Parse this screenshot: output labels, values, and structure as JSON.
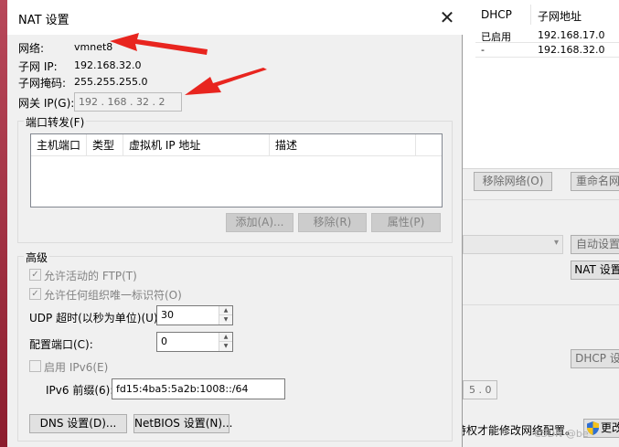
{
  "dialog": {
    "title": "NAT 设置",
    "close_icon": "close-icon",
    "network_label": "网络:",
    "network_value": "vmnet8",
    "subnet_ip_label": "子网 IP:",
    "subnet_ip_value": "192.168.32.0",
    "subnet_mask_label": "子网掩码:",
    "subnet_mask_value": "255.255.255.0",
    "gateway_label": "网关 IP(G):",
    "gateway_value": "192 . 168 . 32 . 2",
    "port_forwarding": {
      "title": "端口转发(F)",
      "columns": [
        "主机端口",
        "类型",
        "虚拟机 IP 地址",
        "描述"
      ],
      "add_button": "添加(A)...",
      "remove_button": "移除(R)",
      "properties_button": "属性(P)"
    },
    "advanced": {
      "title": "高级",
      "allow_ftp": "允许活动的 FTP(T)",
      "allow_ftp_checked": true,
      "allow_oui": "允许任何组织唯一标识符(O)",
      "allow_oui_checked": true,
      "udp_timeout_label": "UDP 超时(以秒为单位)(U):",
      "udp_timeout_value": "30",
      "config_port_label": "配置端口(C):",
      "config_port_value": "0",
      "enable_ipv6": "启用 IPv6(E)",
      "enable_ipv6_checked": false,
      "ipv6_prefix_label": "IPv6 前缀(6):",
      "ipv6_prefix_value": "fd15:4ba5:5a2b:1008::/64"
    },
    "dns_button": "DNS 设置(D)...",
    "netbios_button": "NetBIOS 设置(N)..."
  },
  "background": {
    "columns": [
      "DHCP",
      "子网地址"
    ],
    "rows": [
      {
        "dhcp": "已启用",
        "subnet": "192.168.17.0"
      },
      {
        "dhcp": "-",
        "subnet": "192.168.32.0"
      }
    ],
    "remove_network": "移除网络(O)",
    "rename_network": "重命名网",
    "auto_settings": "自动设置",
    "nat_settings": "NAT 设置",
    "dhcp_settings": "DHCP 设",
    "ip_tail": "5 . 0",
    "admin_text": "特权才能修改网络配置。",
    "modify_button": "更改",
    "shield_icon": "uac-shield-icon",
    "arrow_color": "#e8251f"
  },
  "watermark": "CSDN @be"
}
